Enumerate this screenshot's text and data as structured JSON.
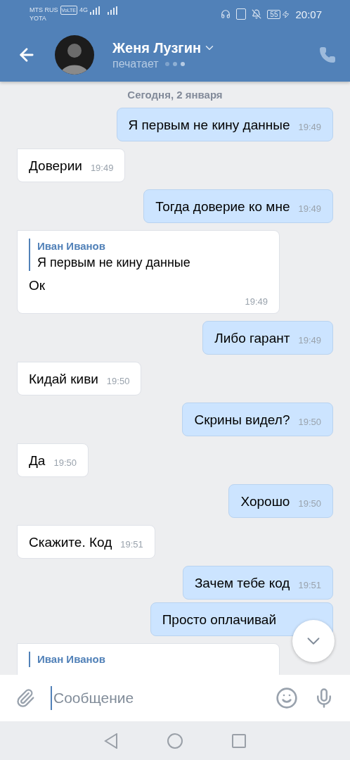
{
  "status_bar": {
    "carrier": "MTS RUS",
    "carrier_2": "YOTA",
    "volte": "VoLTE",
    "network": "4G",
    "battery": "55",
    "time": "20:07"
  },
  "header": {
    "name": "Женя Лузгин",
    "status": "печатает"
  },
  "date_chip": "Сегодня, 2 января",
  "messages": [
    {
      "kind": "text",
      "outgoing": true,
      "text": "Я первым не кину данные",
      "time": "19:49"
    },
    {
      "kind": "text",
      "outgoing": false,
      "text": "Доверии",
      "time": "19:49"
    },
    {
      "kind": "text",
      "outgoing": true,
      "text": "Тогда доверие ко мне",
      "time": "19:49"
    },
    {
      "kind": "reply",
      "outgoing": false,
      "quote_author": "Иван Иванов",
      "quote_text": "Я первым не кину данные",
      "text": "Ок",
      "time": "19:49"
    },
    {
      "kind": "text",
      "outgoing": true,
      "text": "Либо гарант",
      "time": "19:49"
    },
    {
      "kind": "text",
      "outgoing": false,
      "text": "Кидай киви",
      "time": "19:50"
    },
    {
      "kind": "text",
      "outgoing": true,
      "text": "Скрины видел?",
      "time": "19:50"
    },
    {
      "kind": "text",
      "outgoing": false,
      "text": "Да",
      "time": "19:50"
    },
    {
      "kind": "text",
      "outgoing": true,
      "text": "Хорошо",
      "time": "19:50"
    },
    {
      "kind": "text",
      "outgoing": false,
      "text": "Скажите. Код",
      "time": "19:51"
    },
    {
      "kind": "text",
      "outgoing": true,
      "text": "Зачем тебе код",
      "time": "19:51"
    },
    {
      "kind": "text",
      "outgoing": true,
      "text": "Просто оплачивай"
    },
    {
      "kind": "reply",
      "outgoing": false,
      "quote_author": "Иван Иванов"
    }
  ],
  "composer": {
    "placeholder": "Сообщение"
  }
}
